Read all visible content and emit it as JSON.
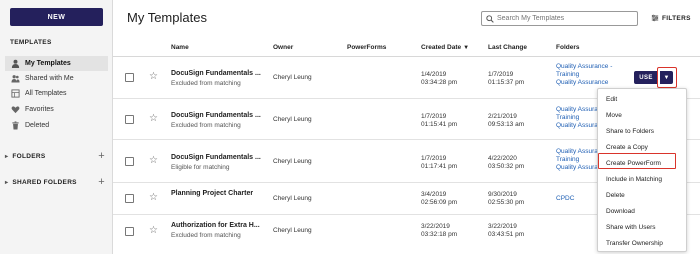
{
  "sidebar": {
    "new_label": "NEW",
    "section_label": "TEMPLATES",
    "items": [
      {
        "label": "My Templates",
        "icon": "user-icon"
      },
      {
        "label": "Shared with Me",
        "icon": "users-icon"
      },
      {
        "label": "All Templates",
        "icon": "grid-icon"
      },
      {
        "label": "Favorites",
        "icon": "heart-icon"
      },
      {
        "label": "Deleted",
        "icon": "trash-icon"
      }
    ],
    "groups": [
      {
        "label": "FOLDERS"
      },
      {
        "label": "SHARED FOLDERS"
      }
    ]
  },
  "header": {
    "title": "My Templates",
    "search_placeholder": "Search My Templates",
    "filters_label": "FILTERS"
  },
  "table": {
    "columns": [
      "Name",
      "Owner",
      "PowerForms",
      "Created Date",
      "Last Change",
      "Folders"
    ],
    "sort_arrow": "▼",
    "rows": [
      {
        "name": "DocuSign Fundamentals ...",
        "sub": "Excluded from matching",
        "owner": "Cheryl Leung",
        "created_date": "1/4/2019",
        "created_time": "03:34:28 pm",
        "changed_date": "1/7/2019",
        "changed_time": "01:15:37 pm",
        "folders": [
          "Quality Assurance -",
          "Training",
          "Quality Assurance"
        ]
      },
      {
        "name": "DocuSign Fundamentals ...",
        "sub": "Excluded from matching",
        "owner": "Cheryl Leung",
        "created_date": "1/7/2019",
        "created_time": "01:15:41 pm",
        "changed_date": "2/21/2019",
        "changed_time": "09:53:13 am",
        "folders": [
          "Quality Assurance -",
          "Training",
          "Quality Assurance"
        ]
      },
      {
        "name": "DocuSign Fundamentals ...",
        "sub": "Eligible for matching",
        "owner": "Cheryl Leung",
        "created_date": "1/7/2019",
        "created_time": "01:17:41 pm",
        "changed_date": "4/22/2020",
        "changed_time": "03:50:32 pm",
        "folders": [
          "Quality Assurance -",
          "Training",
          "Quality Assurance"
        ]
      },
      {
        "name": "Planning Project Charter",
        "sub": "",
        "owner": "Cheryl Leung",
        "created_date": "3/4/2019",
        "created_time": "02:56:09 pm",
        "changed_date": "9/30/2019",
        "changed_time": "02:55:30 pm",
        "folders": [
          "CPDC"
        ]
      },
      {
        "name": "Authorization for Extra H...",
        "sub": "Excluded from matching",
        "owner": "Cheryl Leung",
        "created_date": "3/22/2019",
        "created_time": "03:32:18 pm",
        "changed_date": "3/22/2019",
        "changed_time": "03:43:51 pm",
        "folders": []
      }
    ]
  },
  "actions": {
    "use_label": "USE",
    "caret": "▼"
  },
  "menu": {
    "items": [
      "Edit",
      "Move",
      "Share to Folders",
      "Create a Copy",
      "Create PowerForm",
      "Include in Matching",
      "Delete",
      "Download",
      "Share with Users",
      "Transfer Ownership"
    ]
  },
  "colors": {
    "brand": "#24205c",
    "link": "#1f5fb4",
    "highlight": "#d9342b"
  }
}
